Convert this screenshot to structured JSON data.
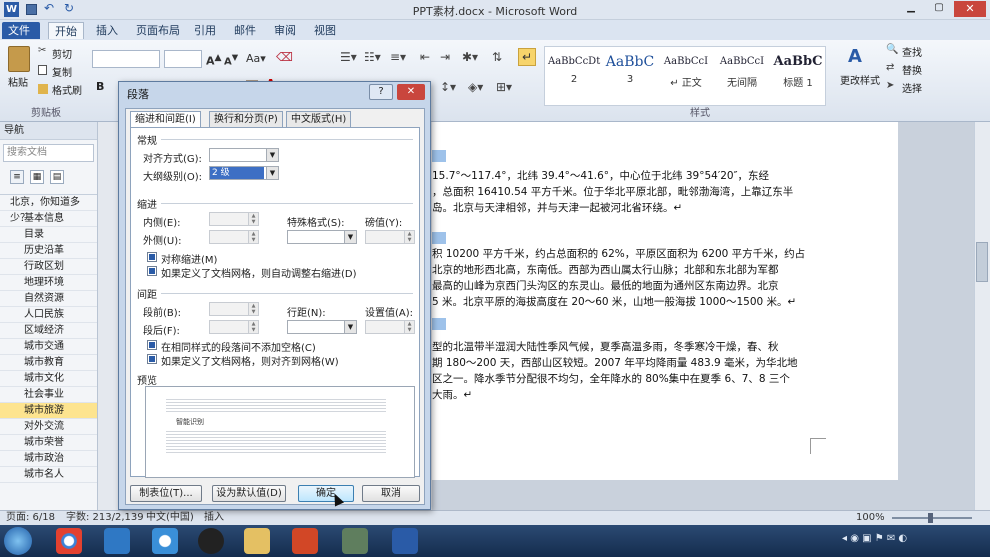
{
  "window": {
    "title": "PPT素材.docx - Microsoft Word"
  },
  "ribbon_tabs": [
    "文件",
    "开始",
    "插入",
    "页面布局",
    "引用",
    "邮件",
    "审阅",
    "视图"
  ],
  "clipboard": {
    "paste": "粘贴",
    "cut": "剪切",
    "copy": "复制",
    "format_painter": "格式刷",
    "group": "剪贴板"
  },
  "styles": {
    "group": "样式",
    "items": [
      {
        "sample": "AaBbCcDt",
        "name": "2"
      },
      {
        "sample": "AaBbC",
        "name": "3"
      },
      {
        "sample": "AaBbCcI",
        "name": "↵ 正文"
      },
      {
        "sample": "AaBbCcI",
        "name": "无间隔"
      },
      {
        "sample": "AaBbC",
        "name": "标题 1"
      }
    ],
    "change_styles": "更改样式"
  },
  "editing": {
    "find": "查找",
    "replace": "替换",
    "select": "选择"
  },
  "nav": {
    "title": "导航",
    "search_placeholder": "搜索文档",
    "items": [
      "北京，你知道多少？",
      "基本信息",
      "目录",
      "历史沿革",
      "行政区划",
      "地理环境",
      "自然资源",
      "人口民族",
      "区域经济",
      "城市交通",
      "城市教育",
      "城市文化",
      "社会事业",
      "城市旅游",
      "对外交流",
      "城市荣誉",
      "城市政治",
      "城市名人"
    ],
    "selected_index": 13
  },
  "document": {
    "lines": [
      "15.7°～117.4°，北纬 39.4°～41.6°，中心位于北纬 39°54′20″，东经",
      "，总面积 16410.54 平方千米。位于华北平原北部，毗邻渤海湾，上靠辽东半",
      "岛。北京与天津相邻，并与天津一起被河北省环绕。↵",
      "积 10200 平方千米，约占总面积的 62%，平原区面积为 6200 平方千米，约占",
      "北京的地形西北高，东南低。西部为西山属太行山脉；北部和东北部为军都",
      "最高的山峰为京西门头沟区的东灵山。最低的地面为通州区东南边界。北京",
      "5 米。北京平原的海拔高度在 20～60 米，山地一般海拔 1000～1500 米。↵",
      "型的北温带半湿润大陆性季风气候，夏季高温多雨，冬季寒冷干燥，春、秋",
      "期 180～200 天，西部山区较短。2007 年平均降雨量 483.9 毫米，为华北地",
      "区之一。降水季节分配很不均匀，全年降水的 80%集中在夏季 6、7、8 三个",
      "大雨。↵"
    ]
  },
  "dialog": {
    "title": "段落",
    "help": "?",
    "tabs": [
      "缩进和间距(I)",
      "换行和分页(P)",
      "中文版式(H)"
    ],
    "general": {
      "heading": "常规",
      "alignment_label": "对齐方式(G):",
      "alignment_value": "",
      "outline_label": "大纲级别(O):",
      "outline_value": "2 级"
    },
    "indent": {
      "heading": "缩进",
      "left_label": "内侧(E):",
      "right_label": "外侧(U):",
      "special_label": "特殊格式(S):",
      "by_label": "磅值(Y):",
      "mirror": "对称缩进(M)",
      "auto_adjust": "如果定义了文档网格，则自动调整右缩进(D)"
    },
    "spacing": {
      "heading": "间距",
      "before_label": "段前(B):",
      "after_label": "段后(F):",
      "line_label": "行距(N):",
      "at_label": "设置值(A):",
      "no_space": "在相同样式的段落间不添加空格(C)",
      "snap_grid": "如果定义了文档网格，则对齐到网格(W)"
    },
    "preview": {
      "heading": "预览",
      "sample": "智能识别"
    },
    "buttons": {
      "tabs": "制表位(T)...",
      "default": "设为默认值(D)",
      "ok": "确定",
      "cancel": "取消"
    }
  },
  "status": {
    "page": "页面: 6/18",
    "words": "字数: 213/2,139",
    "lang": "中文(中国)",
    "mode": "插入",
    "zoom": "100%"
  },
  "colors": {
    "accent": "#2a5ba7",
    "selected_nav": "#fde48f"
  }
}
